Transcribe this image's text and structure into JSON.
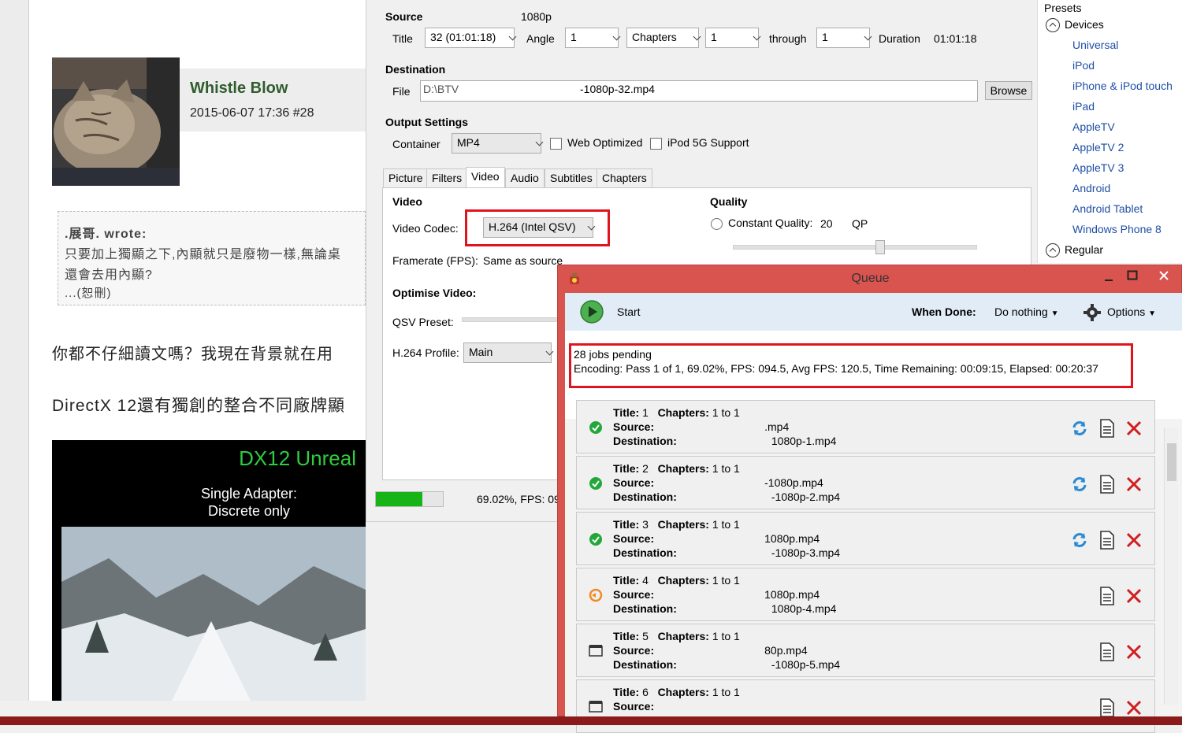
{
  "forum": {
    "username": "Whistle Blow",
    "post_meta": "2015-06-07 17:36  #28",
    "quote_author": ".展哥. wrote:",
    "quote_line1": "只要加上獨顯之下,內顯就只是廢物一樣,無論桌",
    "quote_line2": "還會去用內顯?",
    "quote_line3": "...(恕刪)",
    "para1": "你都不仔細讀文嗎？我現在背景就在用",
    "para2": "DirectX 12還有獨創的整合不同廠牌顯",
    "video_title": "DX12 Unreal",
    "video_sub1": "Single Adapter:",
    "video_sub2": "Discrete only"
  },
  "source": {
    "label": "Source",
    "value": "1080p",
    "title_label": "Title",
    "title_value": "32 (01:01:18)",
    "angle_label": "Angle",
    "angle_value": "1",
    "range_mode": "Chapters",
    "range_start": "1",
    "through_label": "through",
    "range_end": "1",
    "duration_label": "Duration",
    "duration_value": "01:01:18"
  },
  "destination": {
    "label": "Destination",
    "file_label": "File",
    "file_prefix": "D:\\BTV",
    "file_value": "-1080p-32.mp4",
    "browse_label": "Browse"
  },
  "output": {
    "label": "Output Settings",
    "container_label": "Container",
    "container_value": "MP4",
    "web_optimized": "Web Optimized",
    "ipod_support": "iPod 5G Support"
  },
  "tabs": [
    "Picture",
    "Filters",
    "Video",
    "Audio",
    "Subtitles",
    "Chapters"
  ],
  "video": {
    "section": "Video",
    "codec_label": "Video Codec:",
    "codec_value": "H.264 (Intel QSV)",
    "fps_label": "Framerate (FPS):",
    "fps_value": "Same as source",
    "optimise_label": "Optimise Video:",
    "qsv_label": "QSV Preset:",
    "profile_label": "H.264 Profile:",
    "profile_value": "Main",
    "quality_label": "Quality",
    "cq_label": "Constant Quality:",
    "cq_value": "20",
    "cq_unit": "QP"
  },
  "progress": {
    "fraction": 0.6902,
    "text": "69.02%,  FPS: 09"
  },
  "presets": {
    "header": "Presets",
    "devices_label": "Devices",
    "devices": [
      "Universal",
      "iPod",
      "iPhone & iPod touch",
      "iPad",
      "AppleTV",
      "AppleTV 2",
      "AppleTV 3",
      "Android",
      "Android Tablet",
      "Windows Phone 8"
    ],
    "regular_label": "Regular"
  },
  "queue": {
    "title": "Queue",
    "start_label": "Start",
    "when_done_label": "When Done:",
    "when_done_value": "Do nothing",
    "options_label": "Options",
    "jobs_pending": "28 jobs pending",
    "encoding_status": "Encoding: Pass 1 of 1,  69.02%, FPS: 094.5,  Avg FPS: 120.5,  Time Remaining: 00:09:15,  Elapsed: 00:20:37",
    "title_key": "Title:",
    "chapters_key": "Chapters:",
    "source_key": "Source:",
    "dest_key": "Destination:",
    "jobs": [
      {
        "title": "1",
        "chapters": "1  to  1",
        "source": ".mp4",
        "dest": "1080p-1.mp4",
        "status": "done"
      },
      {
        "title": "2",
        "chapters": "1  to  1",
        "source": "-1080p.mp4",
        "dest": "-1080p-2.mp4",
        "status": "done"
      },
      {
        "title": "3",
        "chapters": "1  to  1",
        "source": "1080p.mp4",
        "dest": "-1080p-3.mp4",
        "status": "done"
      },
      {
        "title": "4",
        "chapters": "1  to  1",
        "source": "1080p.mp4",
        "dest": "1080p-4.mp4",
        "status": "encoding"
      },
      {
        "title": "5",
        "chapters": "1  to  1",
        "source": "80p.mp4",
        "dest": "-1080p-5.mp4",
        "status": "waiting"
      },
      {
        "title": "6",
        "chapters": "1  to  1",
        "source": "",
        "dest": "",
        "status": "waiting"
      }
    ]
  },
  "colors": {
    "queue_frame": "#d9534f",
    "highlight_red": "#e0141e",
    "progress_green": "#16b416",
    "preset_link": "#1e4ea6"
  }
}
